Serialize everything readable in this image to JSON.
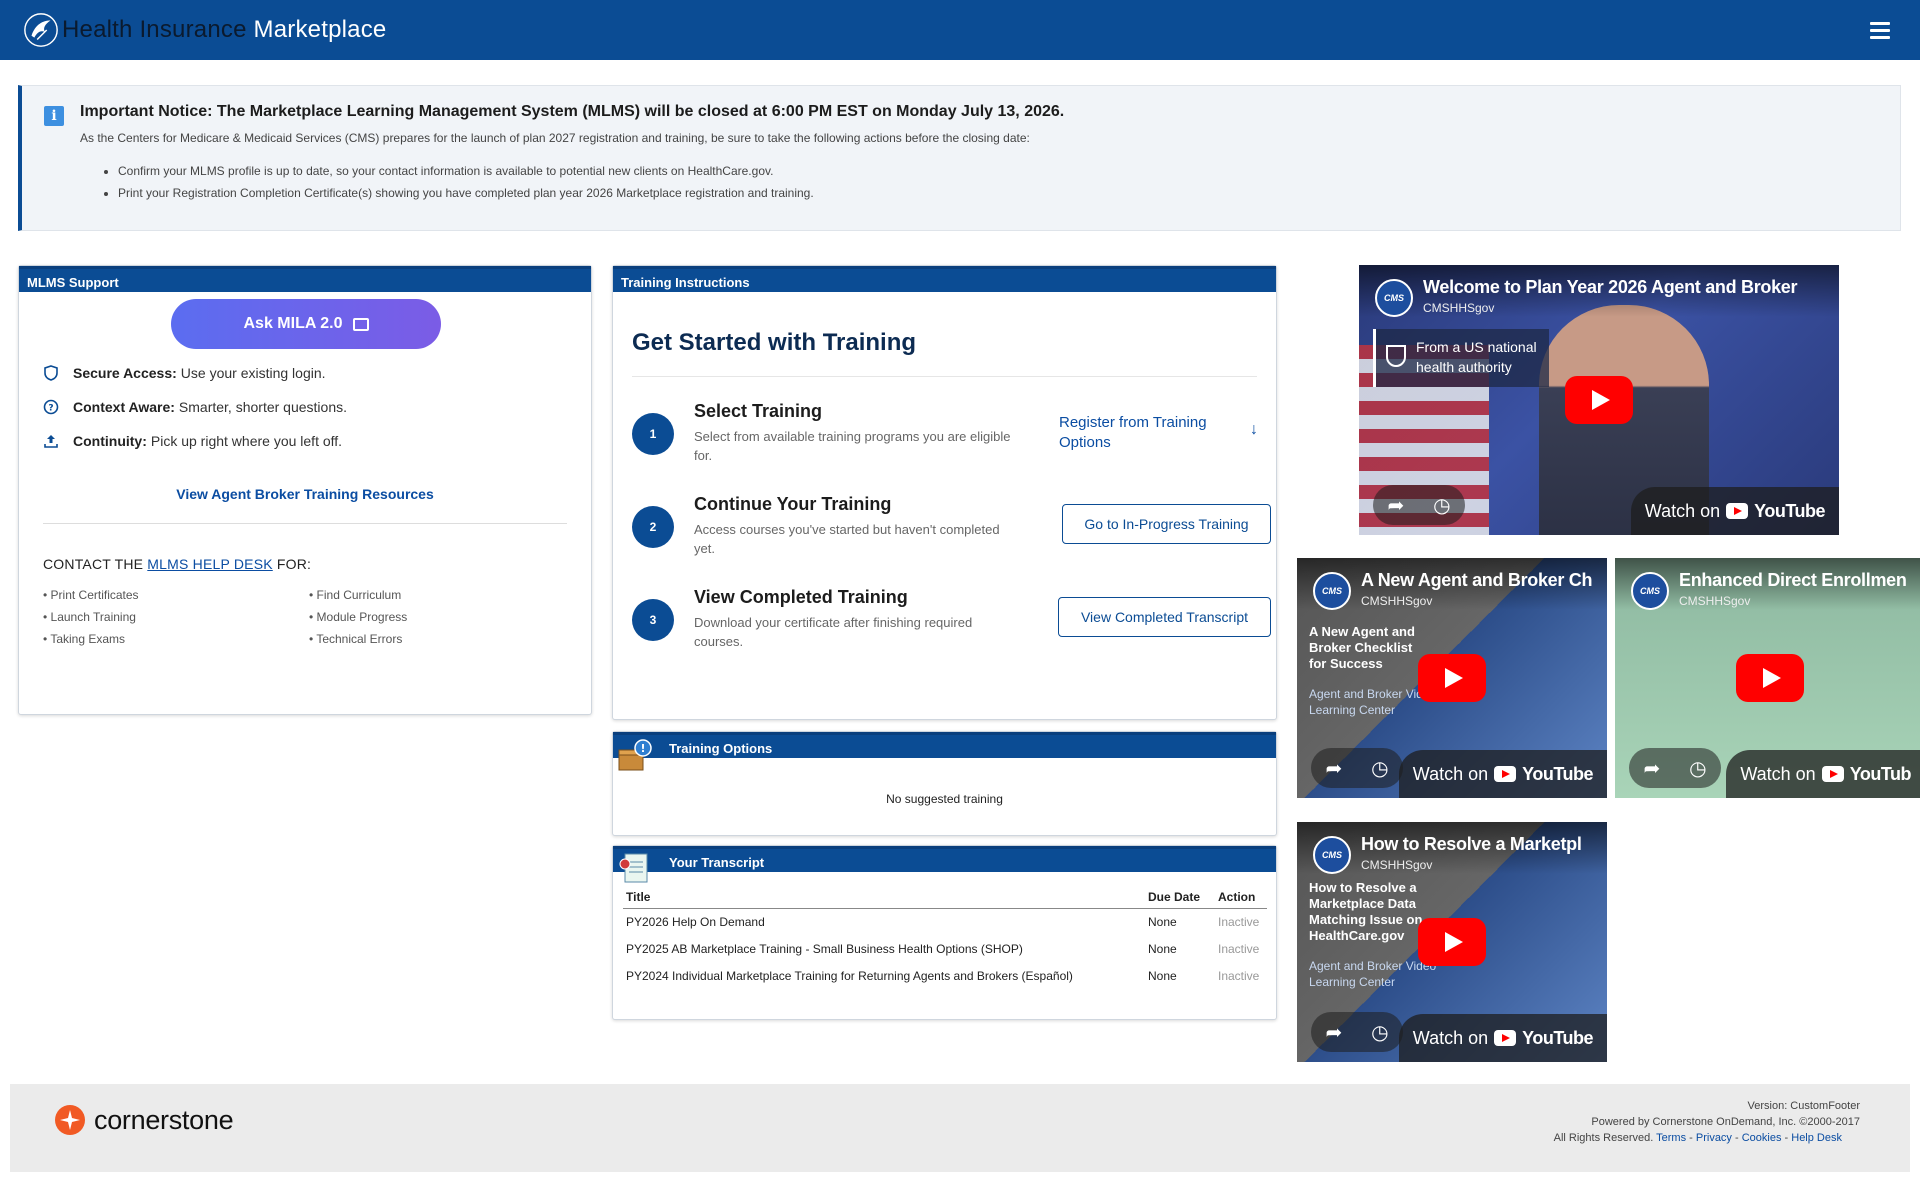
{
  "header": {
    "brand_part1": "Health Insurance",
    "brand_part2": " Marketplace",
    "menu_icon": "hamburger-icon"
  },
  "notice": {
    "title": "Important Notice: The Marketplace Learning Management System (MLMS) will be closed at 6:00 PM EST on Monday July 13, 2026.",
    "description": "As the Centers for Medicare & Medicaid Services (CMS) prepares for the launch of plan 2027 registration and training, be sure to take the following actions before the closing date:",
    "items": [
      "Confirm your MLMS profile is up to date, so your contact information is available to potential new clients on HealthCare.gov.",
      "Print your Registration Completion Certificate(s) showing you have completed plan year 2026 Marketplace registration and training."
    ]
  },
  "support": {
    "heading": "MLMS Support",
    "mila_button": "Ask MILA 2.0",
    "features": [
      {
        "label": "Secure Access:",
        "text": "Use your existing login.",
        "icon": "shield-icon"
      },
      {
        "label": "Context Aware:",
        "text": "Smarter, shorter questions.",
        "icon": "question-icon"
      },
      {
        "label": "Continuity:",
        "text": "Pick up right where you left off.",
        "icon": "upload-icon"
      }
    ],
    "resources_link": "View Agent Broker Training Resources",
    "contact_prefix": "CONTACT THE ",
    "contact_link": "MLMS HELP DESK",
    "contact_suffix": " FOR:",
    "contact_col1": [
      "• Print Certificates",
      "• Launch Training",
      "• Taking Exams"
    ],
    "contact_col2": [
      "• Find Curriculum",
      "• Module Progress",
      "• Technical Errors"
    ]
  },
  "training": {
    "heading": "Training Instructions",
    "title": "Get Started with Training",
    "steps": [
      {
        "num": "1",
        "title": "Select Training",
        "desc": "Select from available training programs you are eligible for.",
        "action": "Register from Training Options",
        "arrow": "↓"
      },
      {
        "num": "2",
        "title": "Continue Your Training",
        "desc": "Access courses you've started but haven't completed yet.",
        "action": "Go to In-Progress Training"
      },
      {
        "num": "3",
        "title": "View Completed Training",
        "desc": "Download your certificate after finishing required courses.",
        "action": "View Completed Transcript"
      }
    ]
  },
  "options": {
    "heading": "Training Options",
    "empty": "No suggested training"
  },
  "transcript": {
    "heading": "Your Transcript",
    "columns": [
      "Title",
      "Due Date",
      "Action"
    ],
    "rows": [
      {
        "title": "PY2026 Help On Demand",
        "due": "None",
        "action": "Inactive"
      },
      {
        "title": "PY2025 AB Marketplace Training - Small Business Health Options (SHOP)",
        "due": "None",
        "action": "Inactive"
      },
      {
        "title": "PY2024 Individual Marketplace Training for Returning Agents and Brokers (Español)",
        "due": "None",
        "action": "Inactive"
      }
    ]
  },
  "videos": {
    "main": {
      "title": "Welcome to Plan Year 2026 Agent and Broker",
      "channel": "CMSHHSgov",
      "authority_line1": "From a US national",
      "authority_line2": "health authority",
      "watch": "Watch on",
      "yt": "YouTube"
    },
    "v1": {
      "title": "A New Agent and Broker Ch",
      "channel": "CMSHHSgov",
      "sub": "A New Agent and Broker Checklist for Success",
      "sub2": "Agent and Broker Video Learning Center",
      "watch": "Watch on",
      "yt": "YouTube"
    },
    "v2": {
      "title": "Enhanced Direct Enrollmen",
      "channel": "CMSHHSgov",
      "watch": "Watch on",
      "yt": "YouTub"
    },
    "v3": {
      "title": "How to Resolve a Marketpl",
      "channel": "CMSHHSgov",
      "sub": "How to Resolve a Marketplace Data Matching Issue on HealthCare.gov",
      "sub2": "Agent and Broker Video Learning Center",
      "watch": "Watch on",
      "yt": "YouTube"
    },
    "cms_badge": "CMS"
  },
  "footer": {
    "brand": "cornerstone",
    "version": "Version: CustomFooter",
    "powered": "Powered by Cornerstone OnDemand, Inc. ©2000-2017",
    "rights": "All Rights Reserved.",
    "links": [
      "Terms",
      "Privacy",
      "Cookies",
      "Help Desk"
    ],
    "sep": " - "
  },
  "colors": {
    "primary": "#0b4c94",
    "link": "#0b4da2",
    "mila_gradient_start": "#5b6df0",
    "mila_gradient_end": "#7b5ce6",
    "youtube_red": "#ff0000",
    "cornerstone_orange": "#f15a24"
  }
}
